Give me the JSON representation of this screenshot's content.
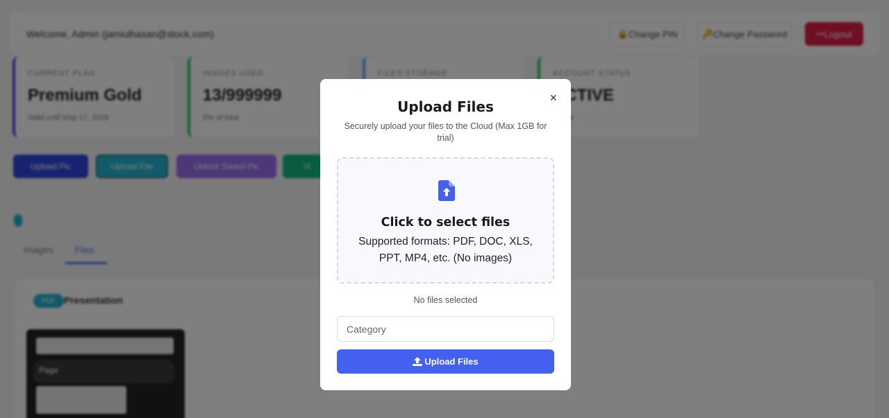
{
  "background": {
    "header": {
      "welcome": "Welcome, Admin (jamiulhasan@stock.com)",
      "change_pin": "Change PIN",
      "change_password": "Change Password",
      "logout": "Logout"
    },
    "stats": [
      {
        "label": "CURRENT PLAN",
        "value": "Premium Gold",
        "sub": "Valid until May 17, 2026"
      },
      {
        "label": "IMAGES USED",
        "value": "13/999999",
        "sub": "0% of total"
      },
      {
        "label": "FILES STORAGE",
        "value": "",
        "sub": ""
      },
      {
        "label": "ACCOUNT STATUS",
        "value": "ACTIVE",
        "sub": "Active"
      }
    ],
    "actions": [
      "Upload Pic",
      "Upload File",
      "Unlock Saved Pic",
      "Vi"
    ],
    "tabs": {
      "images": "Images",
      "files": "Files"
    },
    "presentation": {
      "badge": "PDF",
      "title": "Presentation"
    },
    "thumb_page_label": "Page"
  },
  "modal": {
    "title": "Upload Files",
    "subtitle": "Securely upload your files to the Cloud (Max 1GB for trial)",
    "close_symbol": "×",
    "dropzone": {
      "title": "Click to select files",
      "formats": "Supported formats: PDF, DOC, XLS, PPT, MP4, etc. (No images)"
    },
    "status": "No files selected",
    "category_placeholder": "Category",
    "category_value": "",
    "submit_label": "Upload Files",
    "accent_color": "#4361ee"
  }
}
